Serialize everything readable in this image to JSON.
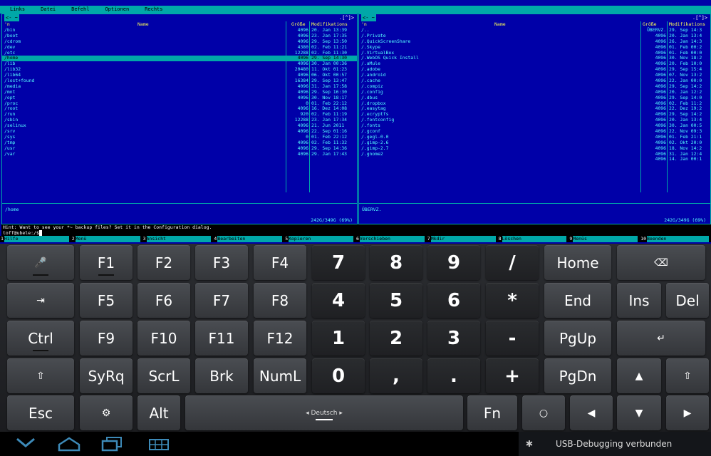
{
  "menu": [
    "Links",
    "Datei",
    "Befehl",
    "Optionen",
    "Rechts"
  ],
  "left_panel": {
    "top_left": "<- ~",
    "top_right": ".[^]>",
    "headers": {
      "n": "'n",
      "name": "Name",
      "size": "Größe",
      "mtime": "Modifikations"
    },
    "rows": [
      {
        "name": "/bin",
        "size": "4096",
        "mtime": "20. Jan 13:39"
      },
      {
        "name": "/boot",
        "size": "4096",
        "mtime": "23. Jan 17:35"
      },
      {
        "name": "/cdrom",
        "size": "4096",
        "mtime": "29. Sep 13:50"
      },
      {
        "name": "/dev",
        "size": "4380",
        "mtime": "02. Feb 11:21"
      },
      {
        "name": "/etc",
        "size": "12288",
        "mtime": "02. Feb 11:30"
      },
      {
        "name": "/home",
        "size": "4096",
        "mtime": "29. Sep 14:30"
      },
      {
        "name": "/lib",
        "size": "4096",
        "mtime": "30. Jan 00:36"
      },
      {
        "name": "/lib32",
        "size": "20480",
        "mtime": "11. Okt 01:23"
      },
      {
        "name": "/lib64",
        "size": "4096",
        "mtime": "06. Okt 00:57"
      },
      {
        "name": "/lost+found",
        "size": "16384",
        "mtime": "29. Sep 13:47"
      },
      {
        "name": "/media",
        "size": "4096",
        "mtime": "31. Jan 17:58"
      },
      {
        "name": "/mnt",
        "size": "4096",
        "mtime": "29. Sep 16:30"
      },
      {
        "name": "/opt",
        "size": "4096",
        "mtime": "30. Nov 18:17"
      },
      {
        "name": "/proc",
        "size": "0",
        "mtime": "01. Feb 22:12"
      },
      {
        "name": "/root",
        "size": "4096",
        "mtime": "16. Dez 14:08"
      },
      {
        "name": "/run",
        "size": "920",
        "mtime": "02. Feb 11:19"
      },
      {
        "name": "/sbin",
        "size": "12288",
        "mtime": "23. Jan 17:34"
      },
      {
        "name": "/selinux",
        "size": "4096",
        "mtime": "21. Jun 2011"
      },
      {
        "name": "/srv",
        "size": "4096",
        "mtime": "22. Sep 01:16"
      },
      {
        "name": "/sys",
        "size": "0",
        "mtime": "01. Feb 22:12"
      },
      {
        "name": "/tmp",
        "size": "4096",
        "mtime": "02. Feb 11:32"
      },
      {
        "name": "/usr",
        "size": "4096",
        "mtime": "29. Sep 14:36"
      },
      {
        "name": "/var",
        "size": "4096",
        "mtime": "29. Jan 17:43"
      }
    ],
    "selected_index": 5,
    "footer_path": "/home",
    "footer_free": "242G/349G (69%)"
  },
  "right_panel": {
    "top_left": "<- ~",
    "top_right": ".[^]>",
    "headers": {
      "n": "'n",
      "name": "Name",
      "size": "Größe",
      "mtime": "Modifikations"
    },
    "rows": [
      {
        "name": "/..",
        "size": "ÜBERVZ.",
        "mtime": "29. Sep 14:3"
      },
      {
        "name": "/.Private",
        "size": "4096",
        "mtime": "20. Jan 13:4"
      },
      {
        "name": "/.QuickScreenShare",
        "size": "4096",
        "mtime": "26. Jan 14:3"
      },
      {
        "name": "/.Skype",
        "size": "4096",
        "mtime": "01. Feb 00:2"
      },
      {
        "name": "/.VirtualBox",
        "size": "4096",
        "mtime": "01. Feb 00:0"
      },
      {
        "name": "/.WebOS Quick Install",
        "size": "4096",
        "mtime": "30. Nov 18:2"
      },
      {
        "name": "/.aMule",
        "size": "4096",
        "mtime": "20. Feb 10:0"
      },
      {
        "name": "/.adobe",
        "size": "4096",
        "mtime": "29. Sep 15:4"
      },
      {
        "name": "/.android",
        "size": "4096",
        "mtime": "07. Nov 13:2"
      },
      {
        "name": "/.cache",
        "size": "4096",
        "mtime": "22. Jan 00:0"
      },
      {
        "name": "/.compiz",
        "size": "4096",
        "mtime": "29. Sep 14:2"
      },
      {
        "name": "/.config",
        "size": "4096",
        "mtime": "20. Jan 12:2"
      },
      {
        "name": "/.dbus",
        "size": "4096",
        "mtime": "29. Sep 14:0"
      },
      {
        "name": "/.dropbox",
        "size": "4096",
        "mtime": "02. Feb 11:2"
      },
      {
        "name": "/.easytag",
        "size": "4096",
        "mtime": "22. Dez 19:2"
      },
      {
        "name": "/.ecryptfs",
        "size": "4096",
        "mtime": "29. Sep 14:2"
      },
      {
        "name": "/.fontconfig",
        "size": "4096",
        "mtime": "20. Jan 13:4"
      },
      {
        "name": "/.fonts",
        "size": "4096",
        "mtime": "30. Jan 00:5"
      },
      {
        "name": "/.gconf",
        "size": "4096",
        "mtime": "22. Nov 09:3"
      },
      {
        "name": "/.gegl-0.0",
        "size": "4096",
        "mtime": "01. Feb 21:1"
      },
      {
        "name": "/.gimp-2.6",
        "size": "4096",
        "mtime": "02. Okt 20:0"
      },
      {
        "name": "/.gimp-2.7",
        "size": "4096",
        "mtime": "18. Nov 14:2"
      },
      {
        "name": "/.gnome2",
        "size": "4096",
        "mtime": "31. Jan 12:4"
      },
      {
        "name": "",
        "size": "4096",
        "mtime": "14. Jan 00:1"
      }
    ],
    "footer_path": "ÜBERVZ.",
    "footer_free": "242G/349G (69%)"
  },
  "hint": "Hint: Want to see your *~ backup files? Set it in the Configuration dialog.",
  "prompt": "toff@ubele:/$",
  "fn_keys": [
    {
      "n": "1",
      "label": "Hilfe"
    },
    {
      "n": "2",
      "label": "Menü"
    },
    {
      "n": "3",
      "label": "Ansicht"
    },
    {
      "n": "4",
      "label": "Bearbeiten"
    },
    {
      "n": "5",
      "label": "Kopieren"
    },
    {
      "n": "6",
      "label": "Verschieben"
    },
    {
      "n": "7",
      "label": "Mkdir"
    },
    {
      "n": "8",
      "label": "Löschen"
    },
    {
      "n": "9",
      "label": "Menüs"
    },
    {
      "n": "10",
      "label": "Beenden"
    }
  ],
  "keyboard": {
    "row1": [
      "🎤",
      "F1",
      "F2",
      "F3",
      "F4",
      "7",
      "8",
      "9",
      "/",
      "Home",
      "⌫"
    ],
    "row2": [
      "⇥",
      "F5",
      "F6",
      "F7",
      "F8",
      "4",
      "5",
      "6",
      "*",
      "End",
      "Ins",
      "Del"
    ],
    "row3": [
      "Ctrl",
      "F9",
      "F10",
      "F11",
      "F12",
      "1",
      "2",
      "3",
      "-",
      "PgUp",
      "↵"
    ],
    "row4": [
      "⇧",
      "SyRq",
      "ScrL",
      "Brk",
      "NumL",
      "0",
      ",",
      ".",
      "+",
      "PgDn",
      "▲",
      "⇧"
    ],
    "row5": [
      "Esc",
      "⚙",
      "Alt",
      "◂ Deutsch ▸",
      "Fn",
      "○",
      "◀",
      "▼",
      "▶"
    ]
  },
  "nav": {
    "back_icon": "back-icon",
    "home_icon": "home-icon",
    "recent_icon": "recent-apps-icon",
    "keyboard_icon": "keyboard-icon"
  },
  "status_text": "USB-Debugging verbunden"
}
